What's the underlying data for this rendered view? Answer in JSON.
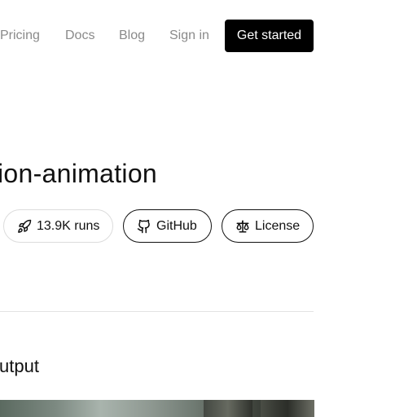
{
  "nav": {
    "links": {
      "pricing": "Pricing",
      "docs": "Docs",
      "blog": "Blog",
      "signin": "Sign in"
    },
    "cta_label": "Get started"
  },
  "model": {
    "title": "ion-animation"
  },
  "pills": {
    "runs": {
      "label": "13.9K runs",
      "icon": "rocket-icon"
    },
    "github": {
      "label": "GitHub",
      "icon": "github-icon"
    },
    "license": {
      "label": "License",
      "icon": "scale-icon"
    }
  },
  "output": {
    "section_title": "utput"
  },
  "colors": {
    "cta_background": "#000000",
    "nav_text": "#8a8a8a",
    "divider": "#e3e3e3",
    "pill_border_light": "#dcdcdc"
  }
}
